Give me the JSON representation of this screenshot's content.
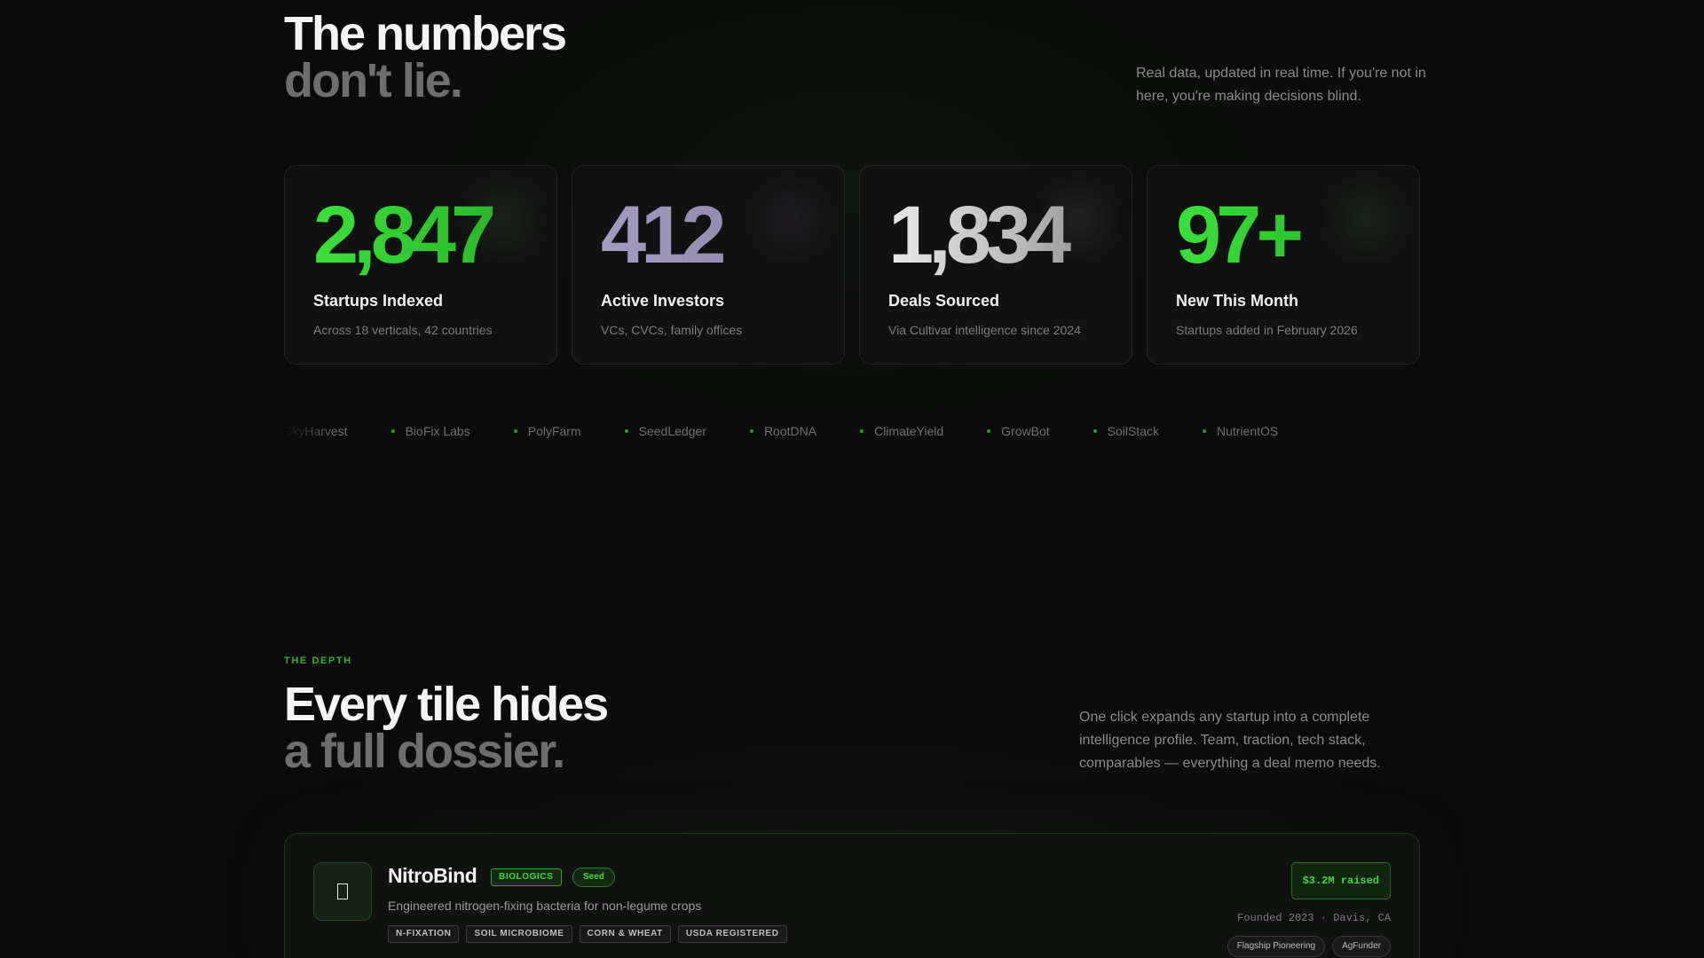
{
  "numbers_section": {
    "title_line1": "The numbers",
    "title_line2": "don't lie.",
    "description": "Real data, updated in real time. If you're not in here, you're making decisions blind.",
    "stats": [
      {
        "value": "2,847",
        "label": "Startups Indexed",
        "sub": "Across 18 verticals, 42 countries",
        "accent": "#2fd72f"
      },
      {
        "value": "412",
        "label": "Active Investors",
        "sub": "VCs, CVCs, family offices",
        "accent": "#9a92b4"
      },
      {
        "value": "1,834",
        "label": "Deals Sourced",
        "sub": "Via Cultivar intelligence since 2024",
        "accent": "#d6d6d6"
      },
      {
        "value": "97+",
        "label": "New This Month",
        "sub": "Startups added in February 2026",
        "accent": "#2fd72f"
      }
    ]
  },
  "marquee": {
    "items": [
      "SkyHarvest",
      "BioFix Labs",
      "PolyFarm",
      "SeedLedger",
      "RootDNA",
      "ClimateYield",
      "GrowBot",
      "SoilStack",
      "NutrientOS"
    ]
  },
  "depth_section": {
    "eyebrow": "THE DEPTH",
    "title_line1": "Every tile hides",
    "title_line2": "a full dossier.",
    "description": "One click expands any startup into a complete intelligence profile. Team, traction, tech stack, comparables — everything a deal memo needs."
  },
  "dossier": {
    "logo_icon": "placeholder-glyph-icon",
    "name": "NitroBind",
    "category_tag": "BIOLOGICS",
    "stage_tag": "Seed",
    "description": "Engineered nitrogen-fixing bacteria for non-legume crops",
    "tags": [
      "N-FIXATION",
      "SOIL MICROBIOME",
      "CORN & WHEAT",
      "USDA REGISTERED"
    ],
    "raised": "$3.2M raised",
    "founded": "Founded 2023 · Davis, CA",
    "investors": [
      "Flagship Pioneering",
      "AgFunder"
    ],
    "accent": "#3ed83e"
  }
}
